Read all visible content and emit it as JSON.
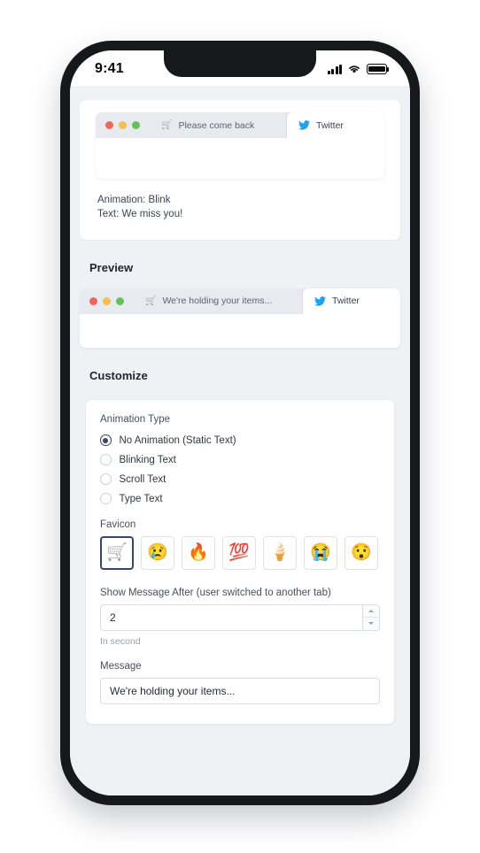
{
  "status_bar": {
    "time": "9:41",
    "signal_icon": "cellular-signal-icon",
    "wifi_icon": "wifi-icon",
    "battery_icon": "battery-full-icon"
  },
  "top_example": {
    "browser": {
      "traffic_lights": [
        "red",
        "yellow",
        "green"
      ],
      "inactive_tab": {
        "favicon": "🛒",
        "title": "Please come back"
      },
      "active_tab": {
        "favicon": "twitter-bird",
        "title": "Twitter"
      }
    },
    "annotation_lines": [
      "Animation: Blink",
      "Text: We miss you!"
    ]
  },
  "preview": {
    "heading": "Preview",
    "browser": {
      "traffic_lights": [
        "red",
        "yellow",
        "green"
      ],
      "inactive_tab": {
        "favicon": "🛒",
        "title": "We're holding your items..."
      },
      "active_tab": {
        "favicon": "twitter-bird",
        "title": "Twitter"
      }
    }
  },
  "customize": {
    "heading": "Customize",
    "animation_type": {
      "label": "Animation Type",
      "selected": "No Animation (Static Text)",
      "options": [
        {
          "label": "No Animation (Static Text)",
          "selected": true
        },
        {
          "label": "Blinking Text",
          "selected": false
        },
        {
          "label": "Scroll Text",
          "selected": false
        },
        {
          "label": "Type Text",
          "selected": false
        }
      ]
    },
    "favicon": {
      "label": "Favicon",
      "selected_index": 0,
      "options": [
        {
          "glyph": "🛒",
          "name": "shopping-cart-emoji",
          "selected": true
        },
        {
          "glyph": "😢",
          "name": "crying-face-emoji",
          "selected": false
        },
        {
          "glyph": "🔥",
          "name": "fire-emoji",
          "selected": false
        },
        {
          "glyph": "💯",
          "name": "hundred-points-emoji",
          "selected": false
        },
        {
          "glyph": "🍦",
          "name": "soft-ice-cream-emoji",
          "selected": false
        },
        {
          "glyph": "😭",
          "name": "loudly-crying-face-emoji",
          "selected": false
        },
        {
          "glyph": "😯",
          "name": "hushed-face-emoji",
          "selected": false
        }
      ]
    },
    "delay": {
      "label": "Show Message After (user switched to another tab)",
      "value": "2",
      "hint": "In second"
    },
    "message": {
      "label": "Message",
      "value": "We're holding your items..."
    }
  },
  "colors": {
    "accent": "#3b4276",
    "screen_bg": "#eff2f5",
    "card_bg": "#ffffff",
    "twitter_blue": "#1da1f2",
    "device_frame": "#17181c"
  }
}
